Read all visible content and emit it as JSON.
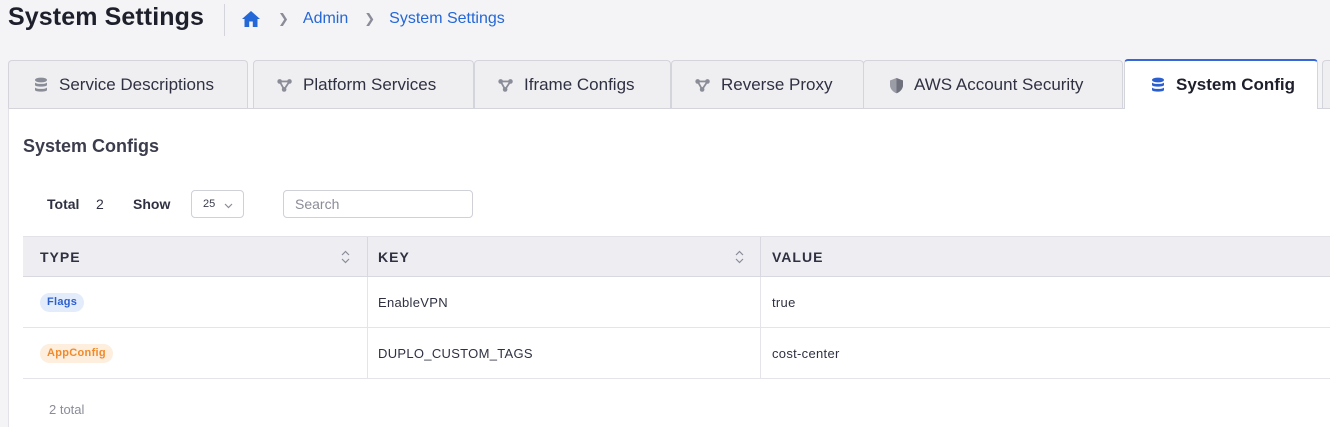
{
  "header": {
    "title": "System Settings",
    "breadcrumb": {
      "home_icon": "home-icon",
      "items": [
        "Admin",
        "System Settings"
      ]
    }
  },
  "tabs": [
    {
      "label": "Service Descriptions",
      "icon": "database-icon",
      "active": false
    },
    {
      "label": "Platform Services",
      "icon": "nodes-icon",
      "active": false
    },
    {
      "label": "Iframe Configs",
      "icon": "nodes-icon",
      "active": false
    },
    {
      "label": "Reverse Proxy",
      "icon": "nodes-icon",
      "active": false
    },
    {
      "label": "AWS Account Security",
      "icon": "shield-icon",
      "active": false
    },
    {
      "label": "System Config",
      "icon": "database-icon",
      "active": true
    }
  ],
  "section": {
    "title": "System Configs"
  },
  "controls": {
    "total_label": "Total",
    "total_value": "2",
    "show_label": "Show",
    "page_size": "25",
    "search_placeholder": "Search"
  },
  "table": {
    "columns": [
      "TYPE",
      "KEY",
      "VALUE"
    ],
    "rows": [
      {
        "type": "Flags",
        "type_color": "blue",
        "key": "EnableVPN",
        "value": "true"
      },
      {
        "type": "AppConfig",
        "type_color": "orange",
        "key": "DUPLO_CUSTOM_TAGS",
        "value": "cost-center"
      }
    ],
    "footer": "2 total"
  },
  "colors": {
    "accent": "#2467d6",
    "active_tab_border": "#3667d8",
    "badge_blue_text": "#2c5fce",
    "badge_orange_text": "#f08a2a"
  }
}
